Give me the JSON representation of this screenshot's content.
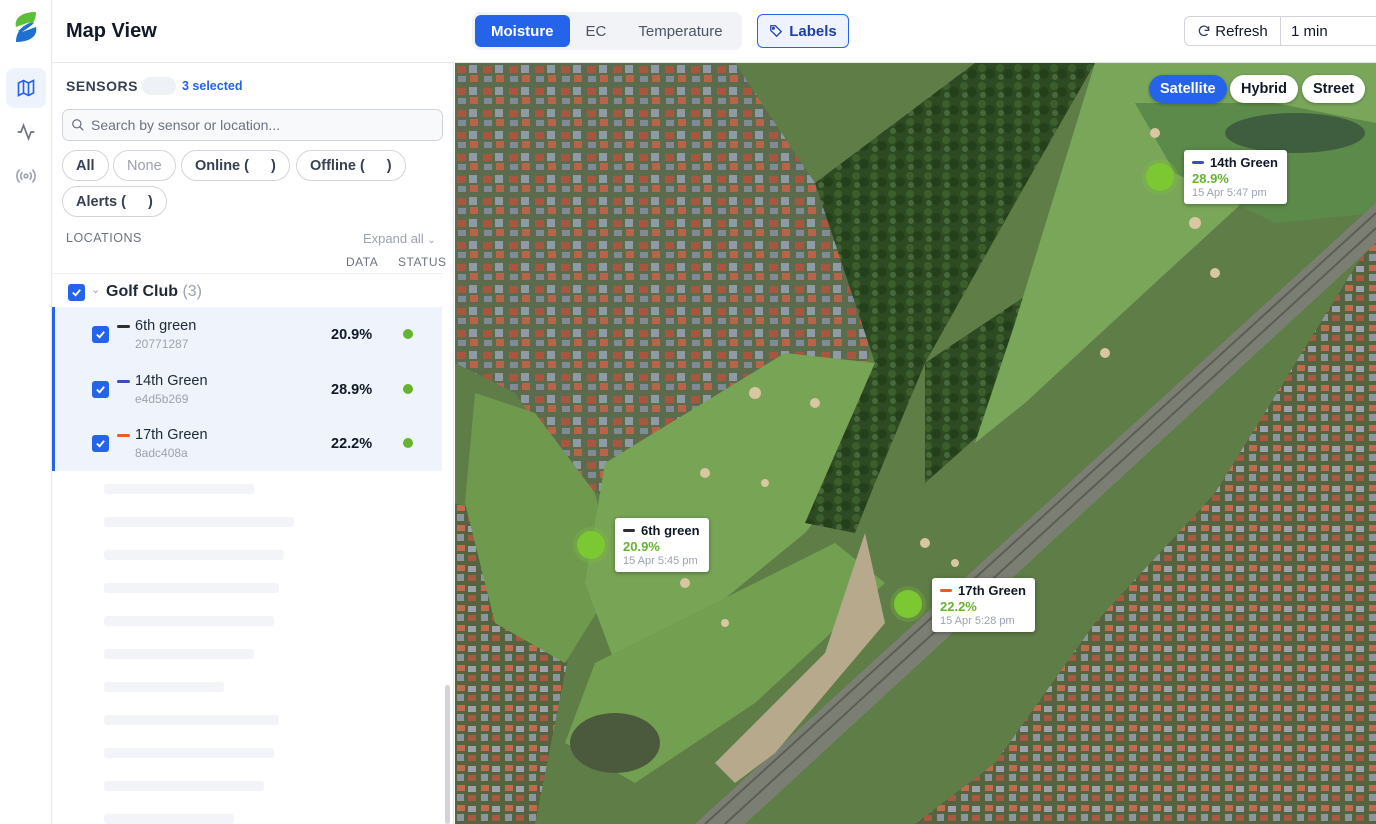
{
  "colors": {
    "accent": "#2563eb",
    "status_online": "#65b32e",
    "moisture_value": "#65b32e"
  },
  "rail": {
    "items": [
      {
        "icon": "map-icon",
        "active": true
      },
      {
        "icon": "activity-icon",
        "active": false
      },
      {
        "icon": "broadcast-icon",
        "active": false
      }
    ]
  },
  "header": {
    "title": "Map View",
    "tabs": [
      {
        "label": "Moisture",
        "active": true
      },
      {
        "label": "EC",
        "active": false
      },
      {
        "label": "Temperature",
        "active": false
      }
    ],
    "labels_button": "Labels",
    "refresh_label": "Refresh",
    "interval_value": "1 min"
  },
  "sidebar": {
    "title": "SENSORS",
    "selected_text": "3 selected",
    "search_placeholder": "Search by sensor or location...",
    "filters": {
      "all": "All",
      "none": "None",
      "online": "Online (",
      "offline": "Offline (",
      "alerts": "Alerts (",
      "close": ")"
    },
    "locations_header": "LOCATIONS",
    "expand_all": "Expand all",
    "col_data": "DATA",
    "col_status": "STATUS",
    "group": {
      "name": "Golf Club",
      "count": "(3)"
    },
    "sensors": [
      {
        "name": "6th green",
        "id": "20771287",
        "value": "20.9%",
        "color": "#2f2f2f"
      },
      {
        "name": "14th Green",
        "id": "e4d5b269",
        "value": "28.9%",
        "color": "#3b4cc0"
      },
      {
        "name": "17th Green",
        "id": "8adc408a",
        "value": "22.2%",
        "color": "#f05a28"
      }
    ]
  },
  "map": {
    "types": [
      {
        "label": "Satellite",
        "active": true
      },
      {
        "label": "Hybrid",
        "active": false
      },
      {
        "label": "Street",
        "active": false
      }
    ],
    "markers": [
      {
        "name": "14th Green",
        "value": "28.9%",
        "time": "15 Apr 5:47 pm",
        "color": "#3b4cc0"
      },
      {
        "name": "6th green",
        "value": "20.9%",
        "time": "15 Apr 5:45 pm",
        "color": "#2f2f2f"
      },
      {
        "name": "17th Green",
        "value": "22.2%",
        "time": "15 Apr 5:28 pm",
        "color": "#f05a28"
      }
    ]
  }
}
